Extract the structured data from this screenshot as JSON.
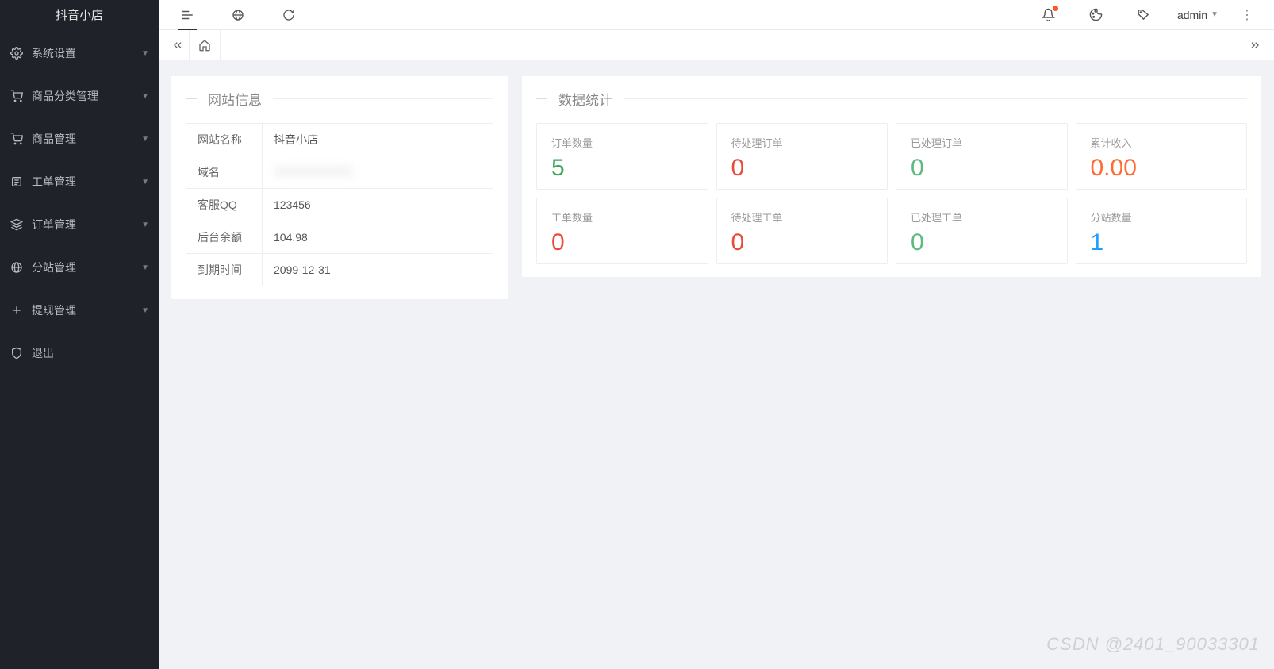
{
  "sidebar": {
    "title": "抖音小店",
    "items": [
      {
        "icon": "gear",
        "label": "系统设置",
        "expandable": true
      },
      {
        "icon": "cart",
        "label": "商品分类管理",
        "expandable": true
      },
      {
        "icon": "cart",
        "label": "商品管理",
        "expandable": true
      },
      {
        "icon": "list",
        "label": "工单管理",
        "expandable": true
      },
      {
        "icon": "layers",
        "label": "订单管理",
        "expandable": true
      },
      {
        "icon": "globe",
        "label": "分站管理",
        "expandable": true
      },
      {
        "icon": "plus",
        "label": "提现管理",
        "expandable": true
      },
      {
        "icon": "shield",
        "label": "退出",
        "expandable": false
      }
    ]
  },
  "topbar": {
    "user": "admin"
  },
  "siteInfo": {
    "title": "网站信息",
    "rows": {
      "site_name_label": "网站名称",
      "site_name_value": "抖音小店",
      "domain_label": "域名",
      "domain_value": "",
      "qq_label": "客服QQ",
      "qq_value": "123456",
      "balance_label": "后台余额",
      "balance_value": "104.98",
      "expire_label": "到期时间",
      "expire_value": "2099-12-31"
    }
  },
  "stats": {
    "title": "数据统计",
    "cards": [
      {
        "label": "订单数量",
        "value": "5",
        "color": "c-green"
      },
      {
        "label": "待处理订单",
        "value": "0",
        "color": "c-red"
      },
      {
        "label": "已处理订单",
        "value": "0",
        "color": "c-green2"
      },
      {
        "label": "累计收入",
        "value": "0.00",
        "color": "c-orange"
      },
      {
        "label": "工单数量",
        "value": "0",
        "color": "c-red"
      },
      {
        "label": "待处理工单",
        "value": "0",
        "color": "c-red"
      },
      {
        "label": "已处理工单",
        "value": "0",
        "color": "c-green2"
      },
      {
        "label": "分站数量",
        "value": "1",
        "color": "c-blue"
      }
    ]
  },
  "watermark": "CSDN @2401_90033301"
}
